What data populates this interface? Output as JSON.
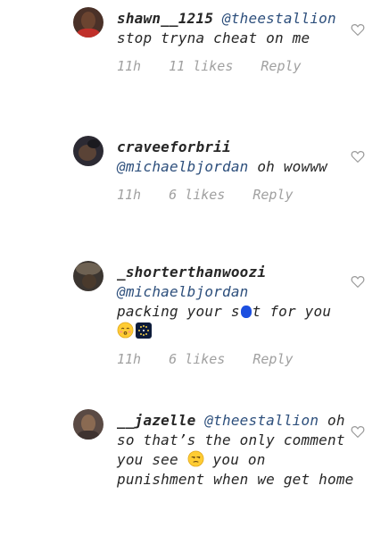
{
  "comments": [
    {
      "username": "shawn__1215",
      "mention": "@theestallion",
      "text": "stop tryna cheat on me",
      "time": "11h",
      "likes": "11 likes",
      "reply": "Reply",
      "avatar_icon": "profile-photo"
    },
    {
      "username": "craveeforbrii",
      "mention": "@michaelbjordan",
      "text": "oh wowww",
      "time": "11h",
      "likes": "6 likes",
      "reply": "Reply",
      "avatar_icon": "profile-photo"
    },
    {
      "username": "_shorterthanwoozi",
      "mention": "@michaelbjordan",
      "text_before": "packing your s",
      "text_after": "t for you",
      "emojis": [
        "kissing-face-emoji",
        "fireworks-emoji"
      ],
      "time": "11h",
      "likes": "6 likes",
      "reply": "Reply",
      "avatar_icon": "profile-photo"
    },
    {
      "username": "__jazelle",
      "mention": "@theestallion",
      "text_before": "oh so that’s the only comment you see",
      "text_after": "you on punishment when we get home",
      "emojis": [
        "unamused-face-emoji"
      ],
      "avatar_icon": "profile-photo"
    }
  ],
  "colors": {
    "mention": "#2d4f7c",
    "meta": "#a0a0a0",
    "censor": "#1c4fe0"
  },
  "icons": {
    "like": "heart-outline-icon"
  }
}
